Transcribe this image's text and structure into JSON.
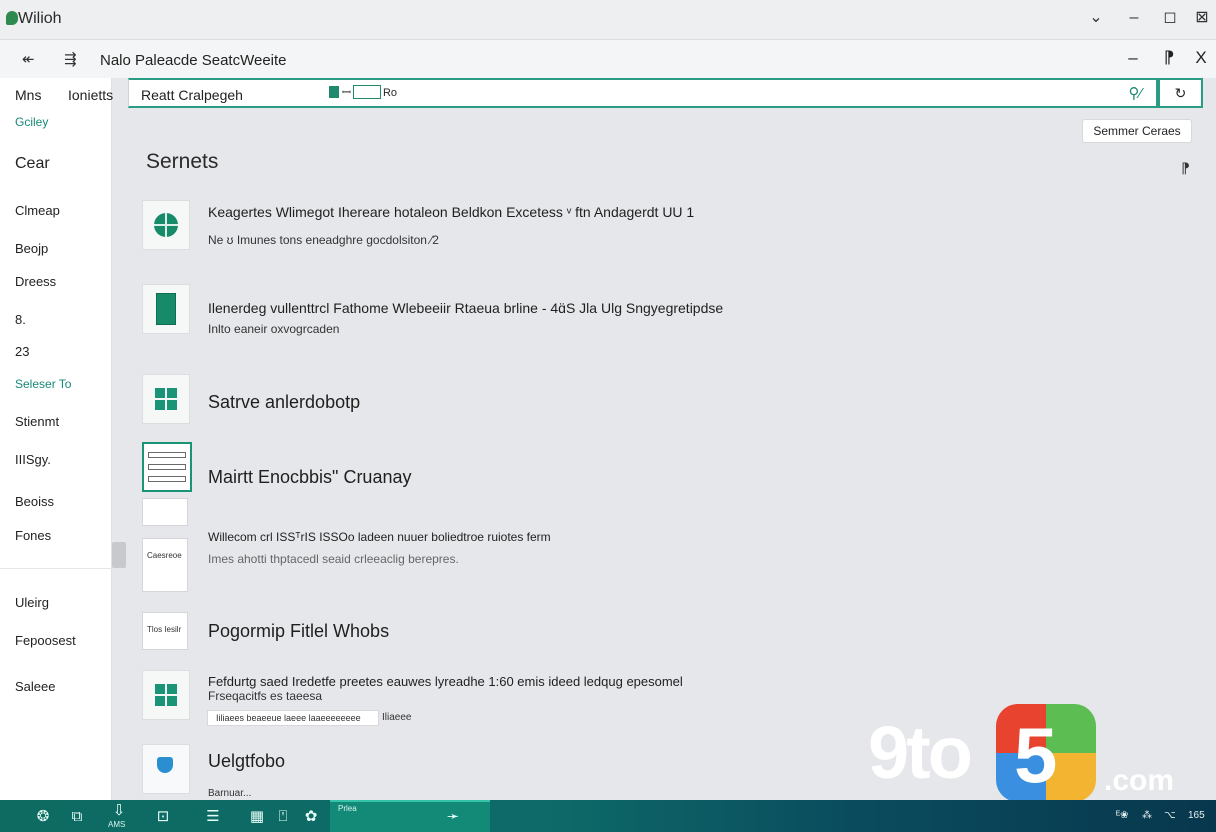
{
  "window": {
    "title": "Wilioh",
    "controls": {
      "chevron": "⌄",
      "minimize": "–",
      "maximize": "◻",
      "close": "⊠"
    }
  },
  "subbar": {
    "back_icon": "↞",
    "pin_icon": "⇶",
    "title": "Nalo Paleacde SeatcWeeite",
    "minimize": "–",
    "pin2": "⁋",
    "close": "X"
  },
  "sidebar": {
    "tabs": [
      "Mns",
      "Ionietts"
    ],
    "items": [
      {
        "label": "Gciley",
        "style": "teal"
      },
      {
        "label": "Cear",
        "style": "big"
      },
      {
        "label": "Clmeap",
        "style": ""
      },
      {
        "label": "Beojp",
        "style": ""
      },
      {
        "label": "Dreess",
        "style": ""
      },
      {
        "label": "8.",
        "style": ""
      },
      {
        "label": "23",
        "style": ""
      },
      {
        "label": "Seleser To",
        "style": "teal"
      },
      {
        "label": "Stienmt",
        "style": ""
      },
      {
        "label": "IIISgy.",
        "style": ""
      },
      {
        "label": "Beoiss",
        "style": ""
      },
      {
        "label": "Fones",
        "style": ""
      },
      {
        "label": "Uleirg",
        "style": ""
      },
      {
        "label": "Fepoosest",
        "style": ""
      },
      {
        "label": "Saleee",
        "style": ""
      }
    ]
  },
  "search": {
    "value": "Reatt Cralpegeh",
    "chip_text": "ꟷ",
    "chip_suffix": "Ro",
    "button_label": "↻",
    "sort_label": "Semmer Ceraes"
  },
  "section_title": "Sernets",
  "side_glyph": "⁋",
  "results": [
    {
      "title": "Keagertes Wlimegot Ihereare hotaleon Beldkon Excetess  ᵛ ftn Andagerdt UU 1",
      "subtitle": "Ne ʊ Imunes tons eneadghre gocdolsiton ⁄2"
    },
    {
      "title": "Ilenerdeg vullenttrcl Fathome Wlebeeiir Rtaeua brline - 4ɑ̈S Jla Ulg Sngyegretipdse",
      "subtitle": "Inlto eaneir oxvogrcaden"
    },
    {
      "title": "Satrve anlerdobotp",
      "subtitle": ""
    },
    {
      "title": "Mairtt Enocbbis\" Cruanay",
      "subtitle": ""
    },
    {
      "title": "Willecom crl ISSᵀrIS ISSOo ladeen nuuer boliedtroe ruiotes ferm",
      "subtitle": "Imes ahotti thptacedl seaid crleeaclig berepres."
    },
    {
      "title": "Pogormip Fitlel Whobs",
      "subtitle": ""
    },
    {
      "title": "Fefdurtg saed  Iredetfe preetes eauwes lyreadhe 1:60 emis ideed ledqug epesomel",
      "subtitle": "Frseqacitfs es taeesa"
    },
    {
      "title": "Uelgtfobo",
      "subtitle": "Barnuar..."
    }
  ],
  "tiles": {
    "sheet_line1": "Basidkelbs",
    "sheet_line2": "",
    "plain_label1": "Caesreoe",
    "plain_label2": "Tlos Iesilr",
    "download_text": "Iiliaees beaeeue laeee laaeeeeeeee",
    "download_tail": "Iliaeee"
  },
  "watermark": {
    "nine": "9to",
    "five": "5",
    "com": ".com"
  },
  "taskbar": {
    "labels": [
      "AMS",
      "Prlea"
    ],
    "tray": [
      "ᴱ❀",
      "⁂",
      "⌥",
      "165"
    ]
  },
  "colors": {
    "accent": "#199476",
    "taskbar": "#0e6b62",
    "background": "#e6e7ea"
  }
}
